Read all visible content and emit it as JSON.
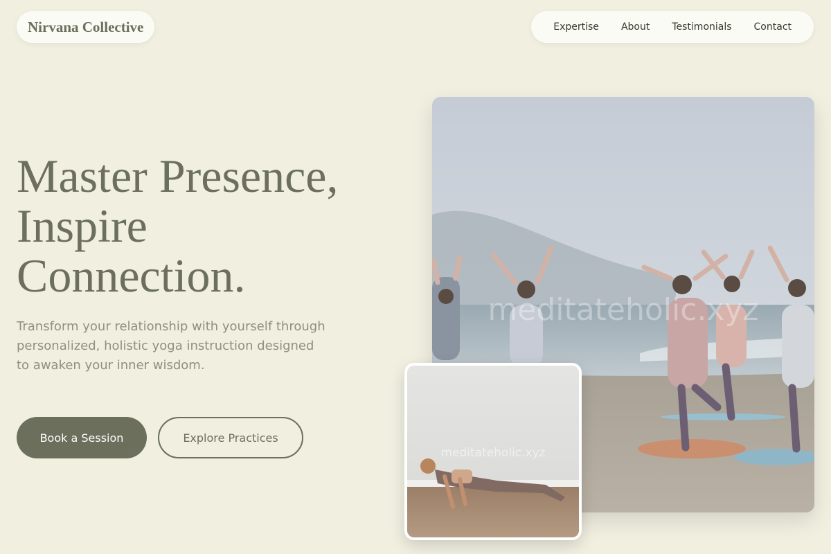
{
  "brand": {
    "name": "Nirvana Collective"
  },
  "nav": {
    "items": [
      "Expertise",
      "About",
      "Testimonials",
      "Contact"
    ]
  },
  "hero": {
    "headline_line1": "Master Presence,",
    "headline_line2": "Inspire",
    "headline_line3": "Connection.",
    "subtitle": "Transform your relationship with yourself through personalized, holistic yoga instruction designed to awaken your inner wisdom.",
    "primary_button": "Book a Session",
    "secondary_button": "Explore Practices"
  },
  "images": {
    "main_watermark": "meditateholic.xyz",
    "inset_watermark": "meditateholic.xyz"
  },
  "colors": {
    "background": "#f0efe0",
    "accent": "#6b6f5c",
    "text_muted": "#8f907e"
  }
}
